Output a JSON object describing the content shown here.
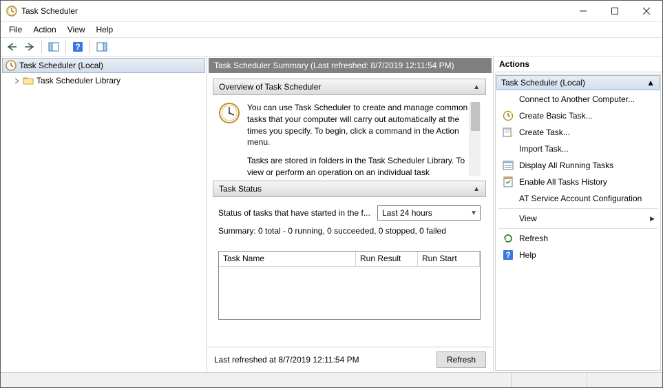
{
  "window": {
    "title": "Task Scheduler"
  },
  "menu": {
    "file": "File",
    "action": "Action",
    "view": "View",
    "help": "Help"
  },
  "tree": {
    "root": "Task Scheduler (Local)",
    "library": "Task Scheduler Library"
  },
  "summary": {
    "header": "Task Scheduler Summary (Last refreshed: 8/7/2019 12:11:54 PM)",
    "overview_title": "Overview of Task Scheduler",
    "overview_p1": "You can use Task Scheduler to create and manage common tasks that your computer will carry out automatically at the times you specify. To begin, click a command in the Action menu.",
    "overview_p2": "Tasks are stored in folders in the Task Scheduler Library. To view or perform an operation on an individual task",
    "status_title": "Task Status",
    "status_label": "Status of tasks that have started in the f...",
    "status_range": "Last 24 hours",
    "status_summary": "Summary: 0 total - 0 running, 0 succeeded, 0 stopped, 0 failed",
    "col_task_name": "Task Name",
    "col_run_result": "Run Result",
    "col_run_start": "Run Start",
    "last_refreshed": "Last refreshed at 8/7/2019 12:11:54 PM",
    "refresh_btn": "Refresh"
  },
  "actions": {
    "panel_title": "Actions",
    "section": "Task Scheduler (Local)",
    "items": [
      {
        "label": "Connect to Another Computer..."
      },
      {
        "label": "Create Basic Task...",
        "icon": "create-basic"
      },
      {
        "label": "Create Task...",
        "icon": "create-task"
      },
      {
        "label": "Import Task..."
      },
      {
        "label": "Display All Running Tasks",
        "icon": "running"
      },
      {
        "label": "Enable All Tasks History",
        "icon": "history"
      },
      {
        "label": "AT Service Account Configuration"
      },
      {
        "label": "View",
        "submenu": true
      },
      {
        "label": "Refresh",
        "icon": "refresh"
      },
      {
        "label": "Help",
        "icon": "help"
      }
    ]
  }
}
